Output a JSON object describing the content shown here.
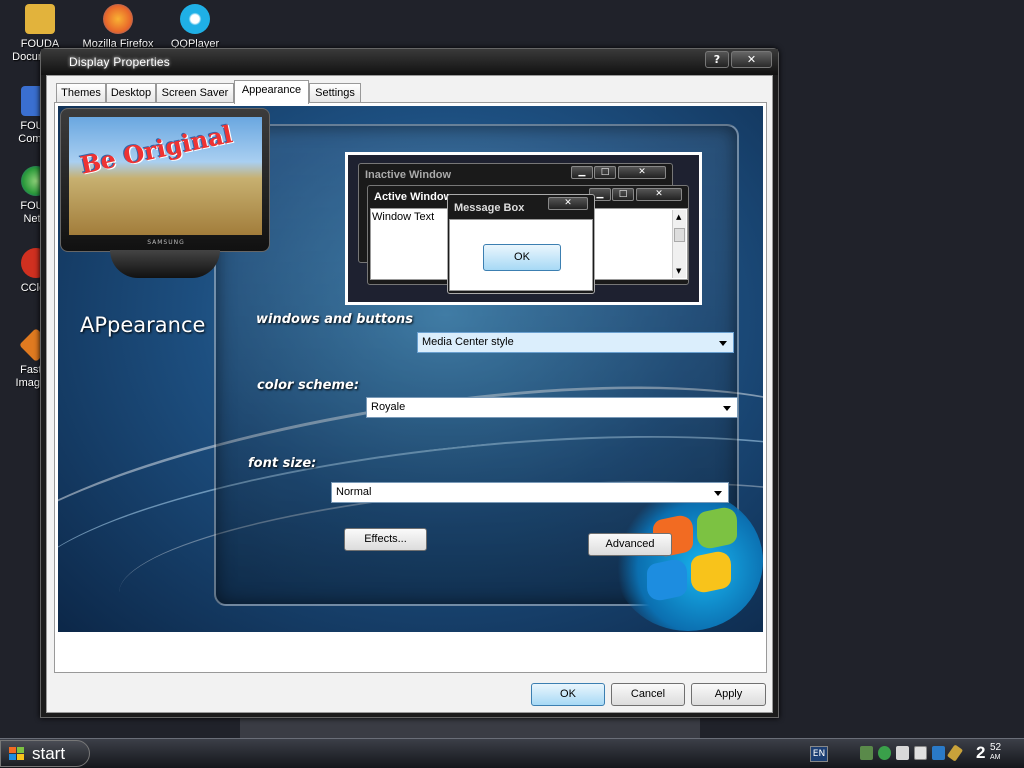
{
  "desktop": {
    "icons": [
      {
        "label": "FOUDA\nDocuments",
        "icon": "folder-icon",
        "color": "#e2b33c"
      },
      {
        "label": "Mozilla Firefox",
        "icon": "firefox-icon",
        "color": "#e8672a"
      },
      {
        "label": "QQPlayer",
        "icon": "qqplayer-icon",
        "color": "#1fb0e6"
      },
      {
        "label": "FOUD\nCompu",
        "icon": "computer-icon",
        "color": "#3a6fd0"
      },
      {
        "label": "FOUD\nNetw",
        "icon": "network-icon",
        "color": "#2a9a3a"
      },
      {
        "label": "CClea",
        "icon": "ccleaner-icon",
        "color": "#d03020"
      },
      {
        "label": "FastSt\nImage V",
        "icon": "faststone-icon",
        "color": "#e07a20"
      }
    ]
  },
  "window": {
    "title": "Display Properties",
    "help_button": "?",
    "close_button": "✕"
  },
  "tabs": [
    {
      "label": "Themes",
      "active": false
    },
    {
      "label": "Desktop",
      "active": false
    },
    {
      "label": "Screen Saver",
      "active": false
    },
    {
      "label": "Appearance",
      "active": true
    },
    {
      "label": "Settings",
      "active": false
    }
  ],
  "monitor": {
    "brand": "SAMSUNG",
    "logo_text": "Be Original"
  },
  "appearance_label": "APpearance",
  "preview": {
    "inactive_title": "Inactive Window",
    "active_title": "Active Window",
    "window_text": "Window Text",
    "message_box_title": "Message Box",
    "ok_label": "OK"
  },
  "form": {
    "windows_buttons_label": "windows and buttons",
    "windows_buttons_value": "Media Center style",
    "color_scheme_label": "color scheme:",
    "color_scheme_value": "Royale",
    "font_size_label": "font size:",
    "font_size_value": "Normal",
    "effects_label": "Effects...",
    "advanced_label": "Advanced"
  },
  "dialog_buttons": {
    "ok": "OK",
    "cancel": "Cancel",
    "apply": "Apply"
  },
  "taskbar": {
    "start_label": "start",
    "language": "EN",
    "clock_hour": "2",
    "clock_minute": "52",
    "clock_ampm": "AM",
    "tray_icons": [
      "tray-network-icon",
      "tray-s-icon",
      "tray-doc-icon",
      "tray-tl-icon",
      "tray-wand-icon"
    ]
  }
}
